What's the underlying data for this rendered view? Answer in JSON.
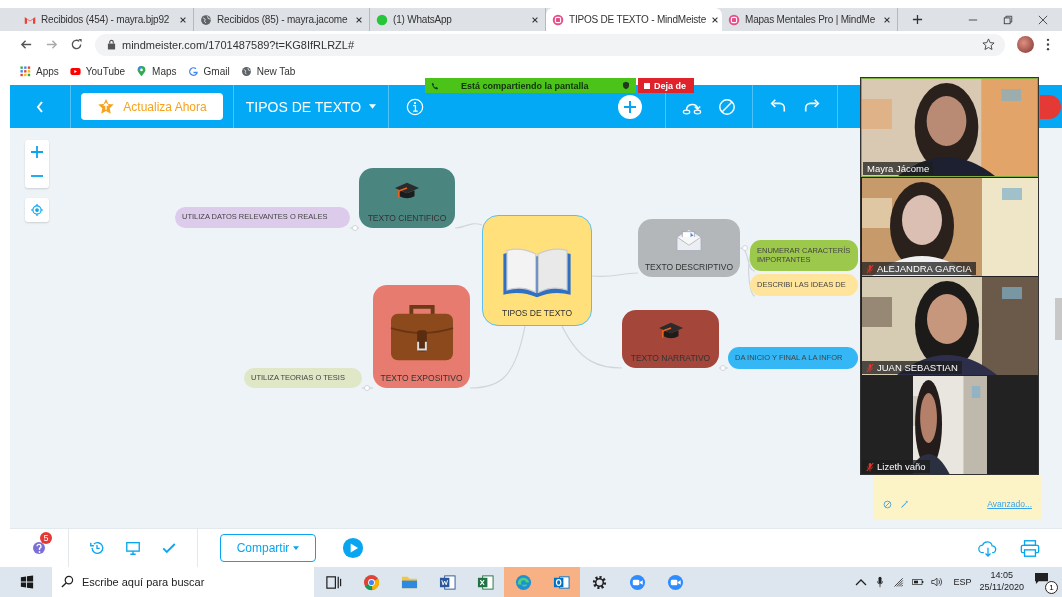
{
  "browser": {
    "tabs": [
      {
        "kind": "gmail",
        "title": "Recibidos (454) - mayra.bjp92",
        "selected": false
      },
      {
        "kind": "globe",
        "title": "Recibidos (85) - mayra.jacome",
        "selected": false
      },
      {
        "kind": "whatsapp",
        "title": "(1) WhatsApp",
        "selected": false
      },
      {
        "kind": "mindmeister",
        "title": "TIPOS DE TEXTO - MindMeiste",
        "selected": true
      },
      {
        "kind": "mindmeister",
        "title": "Mapas Mentales Pro | MindMe",
        "selected": false
      }
    ],
    "address": "mindmeister.com/1701487589?t=KG8IfRLRZL#",
    "bookmarks": [
      {
        "kind": "apps",
        "label": "Apps"
      },
      {
        "kind": "youtube",
        "label": "YouTube"
      },
      {
        "kind": "maps",
        "label": "Maps"
      },
      {
        "kind": "google",
        "label": "Gmail"
      },
      {
        "kind": "globe",
        "label": "New Tab"
      }
    ]
  },
  "share_banner": {
    "text": "Está compartiendo la pantalla",
    "stop": "Deja de"
  },
  "toolbar": {
    "upgrade": "Actualiza Ahora",
    "map_title": "TIPOS DE TEXTO"
  },
  "mindmap": {
    "center": {
      "label": "TIPOS DE TEXTO",
      "color": "#ffe07a"
    },
    "topics": [
      {
        "kind": "cap",
        "label": "TEXTO CIENTIFICO",
        "color": "#4a8580",
        "children": [
          {
            "label": "UTILIZA DATOS RELEVANTES O REALES",
            "color": "#dccbea"
          }
        ]
      },
      {
        "kind": "briefcase",
        "label": "TEXTO EXPOSITIVO",
        "color": "#e87b70",
        "children": [
          {
            "label": "UTILIZA TEORIAS O TESIS",
            "color": "#dfe7c6"
          }
        ]
      },
      {
        "kind": "envelope",
        "label": "TEXTO DESCRIPTIVO",
        "color": "#b3b7b9",
        "children": [
          {
            "label": "ENUMERAR CARACTERÍS IMPORTANTES",
            "color": "#9cc84c"
          },
          {
            "label": "DESCRIBI LAS IDEAS DE",
            "color": "#ffe49c"
          }
        ]
      },
      {
        "kind": "cap",
        "label": "TEXTO NARRATIVO",
        "color": "#a5463b",
        "children": [
          {
            "label": "DA INICIO Y FINAL A LA INFOR",
            "color": "#35b6f5"
          }
        ]
      }
    ]
  },
  "video_call": {
    "participants": [
      {
        "name": "Mayra Jácome",
        "muted": false
      },
      {
        "name": "ALEJANDRA GARCIA",
        "muted": true
      },
      {
        "name": "JUAN SEBASTIAN",
        "muted": true
      },
      {
        "name": "Lizeth vaño",
        "muted": true
      }
    ]
  },
  "notes": {
    "link": "Avanzado..."
  },
  "bottom_bar": {
    "help_badge": "5",
    "share": "Compartir"
  },
  "taskbar": {
    "search_placeholder": "Escribe aquí para buscar",
    "apps": [
      {
        "kind": "taskview",
        "highlighted": false
      },
      {
        "kind": "chrome",
        "highlighted": false
      },
      {
        "kind": "explorer",
        "highlighted": false
      },
      {
        "kind": "word",
        "highlighted": false
      },
      {
        "kind": "excel",
        "highlighted": false
      },
      {
        "kind": "edge",
        "highlighted": true
      },
      {
        "kind": "outlook",
        "highlighted": true
      },
      {
        "kind": "settings",
        "highlighted": false
      },
      {
        "kind": "zoom",
        "highlighted": false
      },
      {
        "kind": "zoom",
        "highlighted": false
      }
    ],
    "language": "ESP",
    "time": "14:05",
    "date": "25/11/2020",
    "notifications": "1"
  }
}
